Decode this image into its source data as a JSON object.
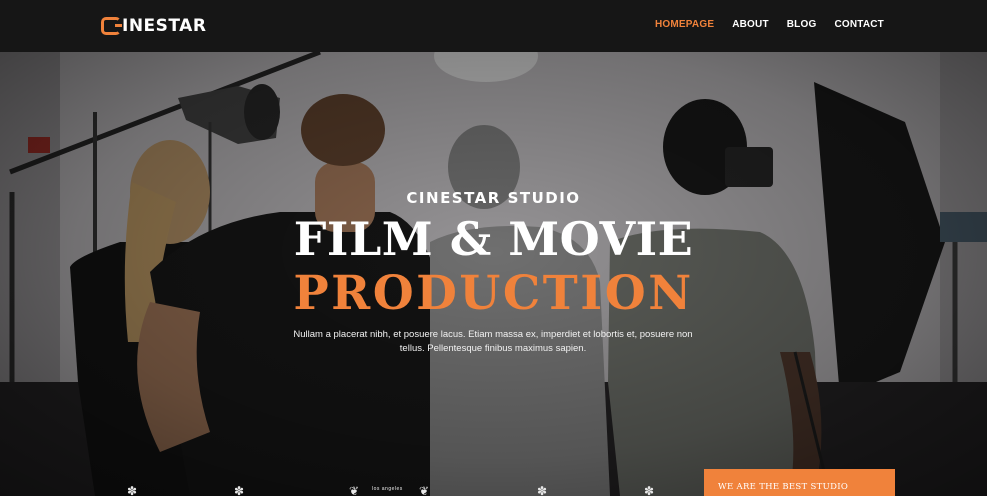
{
  "brand": {
    "logo_text": "INESTAR",
    "accent": "#f0823b"
  },
  "nav": [
    {
      "label": "HOMEPAGE",
      "active": true
    },
    {
      "label": "ABOUT",
      "active": false
    },
    {
      "label": "BLOG",
      "active": false
    },
    {
      "label": "CONTACT",
      "active": false
    }
  ],
  "hero": {
    "eyebrow": "CINESTAR STUDIO",
    "title_line1": "FILM & MOVIE",
    "title_line2": "PRODUCTION",
    "description": "Nullam a placerat nibh, et posuere lacus. Etiam massa ex, imperdiet et lobortis et, posuere non tellus. Pellentesque finibus maximus sapien."
  },
  "badges": {
    "award_text": "los angeles"
  },
  "cta_box": {
    "label": "WE ARE THE BEST STUDIO"
  }
}
